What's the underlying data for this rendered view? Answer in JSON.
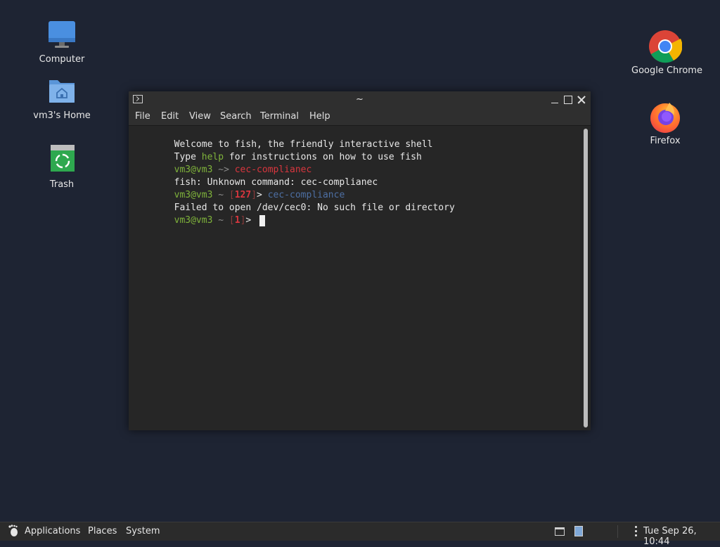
{
  "desktop": {
    "icons_left": [
      {
        "label": "Computer",
        "icon": "computer-icon"
      },
      {
        "label": "vm3's Home",
        "icon": "home-folder-icon"
      },
      {
        "label": "Trash",
        "icon": "trash-icon"
      }
    ],
    "icons_right": [
      {
        "label": "Google Chrome",
        "icon": "chrome-icon"
      },
      {
        "label": "Firefox",
        "icon": "firefox-icon"
      }
    ]
  },
  "terminal": {
    "title": "~",
    "menu": [
      "File",
      "Edit",
      "View",
      "Search",
      "Terminal",
      "Help"
    ],
    "lines": {
      "l1": "Welcome to fish, the friendly interactive shell",
      "l2_pre": "Type ",
      "l2_help": "help",
      "l2_post": " for instructions on how to use fish",
      "l3_user": "vm3@vm3",
      "l3_sep": " ~> ",
      "l3_cmd": "cec-complianec",
      "l4": "fish: Unknown command: cec-complianec",
      "l5_user": "vm3@vm3",
      "l5_tilde": " ~ ",
      "l5_lb": "[",
      "l5_code": "127",
      "l5_rb": "]",
      "l5_gt": "> ",
      "l5_cmd": "cec-compliance",
      "l6": "Failed to open /dev/cec0: No such file or directory",
      "l7_user": "vm3@vm3",
      "l7_tilde": " ~ ",
      "l7_lb": "[",
      "l7_code": "1",
      "l7_rb": "]",
      "l7_gt": "> "
    }
  },
  "taskbar": {
    "applications": "Applications",
    "places": "Places",
    "system": "System",
    "clock": "Tue Sep 26, 10:44"
  },
  "colors": {
    "desktop_bg": "#1e2433",
    "terminal_bg": "#262626",
    "prompt_green": "#7fb33b",
    "error_red": "#d9363e",
    "command_blue": "#4d6fa3"
  }
}
